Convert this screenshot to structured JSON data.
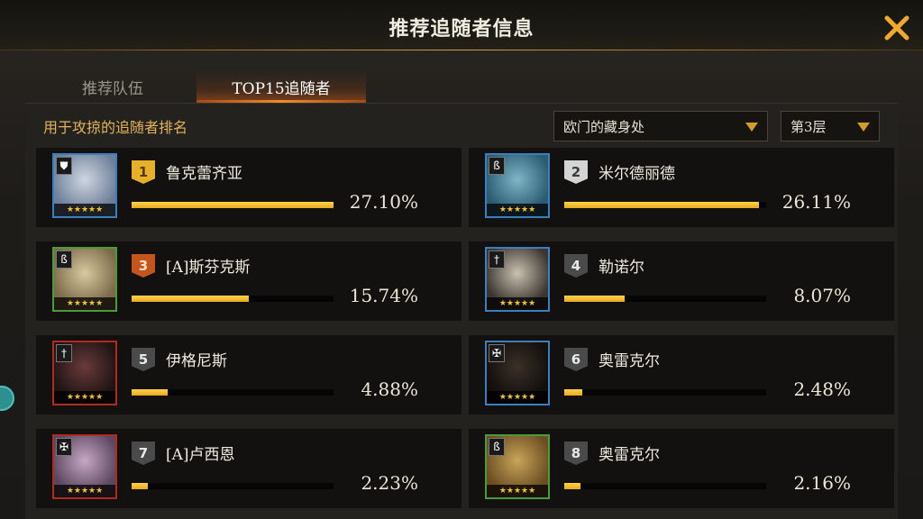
{
  "header": {
    "title": "推荐追随者信息"
  },
  "tabs": [
    {
      "label": "推荐队伍",
      "active": false
    },
    {
      "label": "TOP15追随者",
      "active": true
    }
  ],
  "panel": {
    "subtitle": "用于攻掠的追随者排名",
    "location_dropdown": "欧门的藏身处",
    "floor_dropdown": "第3层"
  },
  "colors": {
    "accent": "#e3b35a",
    "bar": "#f2bd35",
    "tab_active": "#f08a2c"
  },
  "followers": [
    {
      "rank": "1",
      "name": "鲁克蕾齐亚",
      "percent_text": "27.10%",
      "percent": 27.1,
      "badge": "gold",
      "border": "blue",
      "class_icon": "shield-icon",
      "stars": "★★★★★"
    },
    {
      "rank": "2",
      "name": "米尔德丽德",
      "percent_text": "26.11%",
      "percent": 26.11,
      "badge": "silver",
      "border": "blue",
      "class_icon": "staff-icon",
      "stars": "★★★★★"
    },
    {
      "rank": "3",
      "name": "[A]斯芬克斯",
      "percent_text": "15.74%",
      "percent": 15.74,
      "badge": "bronze",
      "border": "green",
      "class_icon": "staff-icon",
      "stars": "★★★★★"
    },
    {
      "rank": "4",
      "name": "勒诺尔",
      "percent_text": "8.07%",
      "percent": 8.07,
      "badge": "plain",
      "border": "blue",
      "class_icon": "dagger-icon",
      "stars": "★★★★★"
    },
    {
      "rank": "5",
      "name": "伊格尼斯",
      "percent_text": "4.88%",
      "percent": 4.88,
      "badge": "plain",
      "border": "red",
      "class_icon": "dagger-icon",
      "stars": "★★★★★"
    },
    {
      "rank": "6",
      "name": "奥雷克尔",
      "percent_text": "2.48%",
      "percent": 2.48,
      "badge": "plain",
      "border": "blue",
      "class_icon": "cross-icon",
      "stars": "★★★★★"
    },
    {
      "rank": "7",
      "name": "[A]卢西恩",
      "percent_text": "2.23%",
      "percent": 2.23,
      "badge": "plain",
      "border": "red",
      "class_icon": "cross-icon",
      "stars": "★★★★★"
    },
    {
      "rank": "8",
      "name": "奥雷克尔",
      "percent_text": "2.16%",
      "percent": 2.16,
      "badge": "plain",
      "border": "green",
      "class_icon": "staff-icon",
      "stars": "★★★★★"
    }
  ]
}
